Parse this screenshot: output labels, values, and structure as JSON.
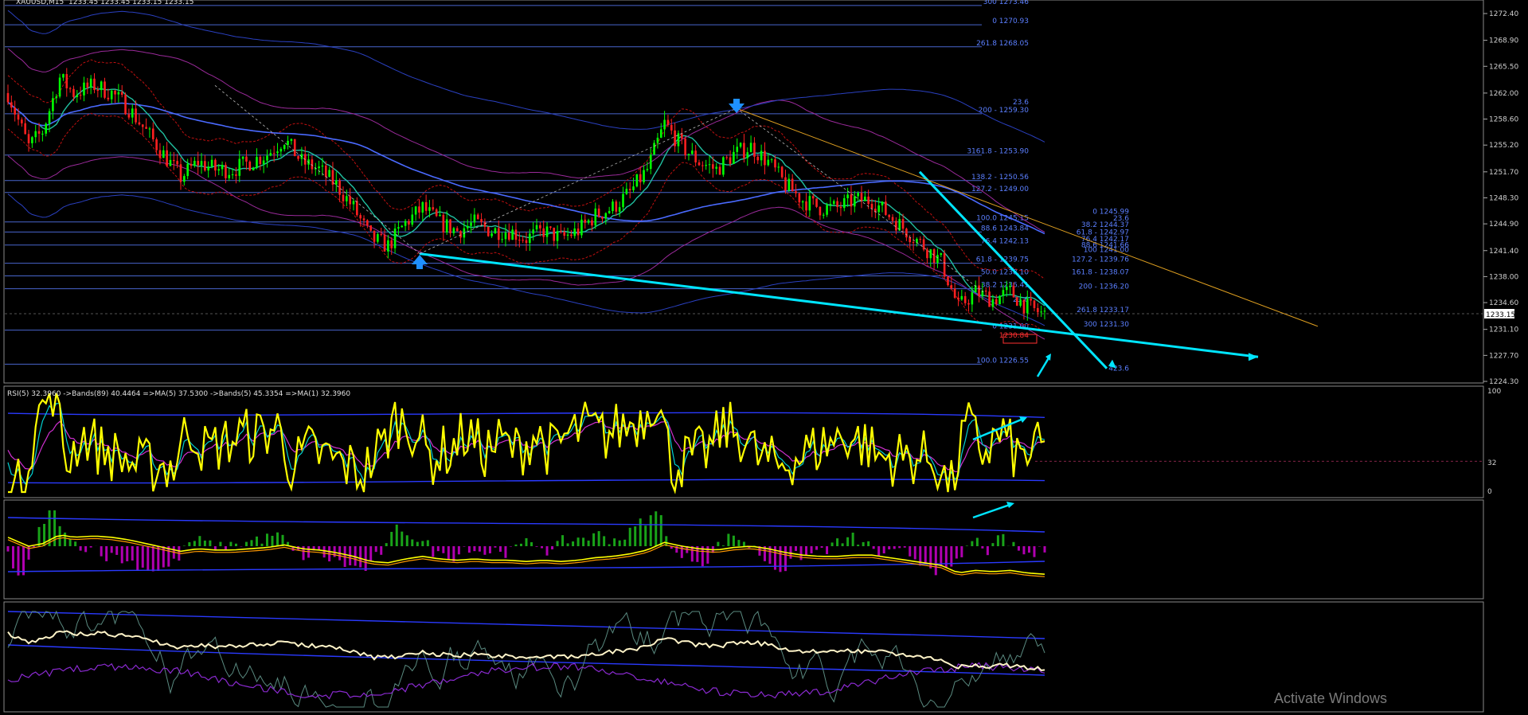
{
  "window": {
    "symbol_label": "XAUUSD,M15",
    "ohlc_label": "1233.45 1233.45 1233.15 1233.15"
  },
  "panes": {
    "rsi_label": "RSI(5) 32.3960 ->Bands(89) 40.4464 =>MA(5) 37.5300 ->Bands(5) 45.3354 =>MA(1) 32.3960",
    "rsi_scale": [
      "100",
      "32",
      "0"
    ]
  },
  "watermark": "Activate Windows",
  "colors": {
    "bull": "#00ff00",
    "bear": "#ff2020",
    "fib": "#5b7fff",
    "trend": "#00e5ff",
    "rsi": "#ffff00",
    "hist_up": "#19a319",
    "hist_down": "#b000b0"
  },
  "chart_data": {
    "type": "candlestick",
    "symbol": "XAUUSD",
    "timeframe": "M15",
    "ylim": [
      1224.3,
      1274.0
    ],
    "y_ticks": [
      "1272.40",
      "1268.90",
      "1265.50",
      "1262.00",
      "1258.60",
      "1255.20",
      "1251.70",
      "1248.30",
      "1244.90",
      "1241.40",
      "1238.00",
      "1234.60",
      "1231.10",
      "1227.70",
      "1224.30"
    ],
    "current_price": "1233.15",
    "price_path": [
      [
        0,
        1262
      ],
      [
        5,
        1259
      ],
      [
        12,
        1255
      ],
      [
        20,
        1257
      ],
      [
        30,
        1264
      ],
      [
        38,
        1262
      ],
      [
        50,
        1263
      ],
      [
        60,
        1262
      ],
      [
        70,
        1260
      ],
      [
        80,
        1257
      ],
      [
        90,
        1254
      ],
      [
        100,
        1251
      ],
      [
        110,
        1253
      ],
      [
        120,
        1252
      ],
      [
        130,
        1252
      ],
      [
        140,
        1253
      ],
      [
        150,
        1254
      ],
      [
        160,
        1256
      ],
      [
        170,
        1253
      ],
      [
        180,
        1252
      ],
      [
        190,
        1250
      ],
      [
        200,
        1247
      ],
      [
        210,
        1243
      ],
      [
        220,
        1242
      ],
      [
        230,
        1245
      ],
      [
        240,
        1247
      ],
      [
        250,
        1245
      ],
      [
        260,
        1244
      ],
      [
        270,
        1245
      ],
      [
        280,
        1244
      ],
      [
        290,
        1244
      ],
      [
        300,
        1243
      ],
      [
        310,
        1244
      ],
      [
        320,
        1243
      ],
      [
        330,
        1244
      ],
      [
        340,
        1246
      ],
      [
        350,
        1247
      ],
      [
        360,
        1249
      ],
      [
        370,
        1252
      ],
      [
        380,
        1258
      ],
      [
        390,
        1255
      ],
      [
        400,
        1253
      ],
      [
        410,
        1252
      ],
      [
        420,
        1254
      ],
      [
        430,
        1255
      ],
      [
        440,
        1253
      ],
      [
        450,
        1250
      ],
      [
        460,
        1248
      ],
      [
        470,
        1247
      ],
      [
        480,
        1247
      ],
      [
        490,
        1248
      ],
      [
        500,
        1248
      ],
      [
        510,
        1246
      ],
      [
        520,
        1244
      ],
      [
        530,
        1242
      ],
      [
        540,
        1240
      ],
      [
        550,
        1234
      ],
      [
        560,
        1236
      ],
      [
        570,
        1235
      ],
      [
        580,
        1236
      ],
      [
        590,
        1234
      ],
      [
        600,
        1233
      ]
    ],
    "fib_levels": [
      {
        "label": "300 1273.46",
        "price": 1273.46
      },
      {
        "label": "0 1270.93",
        "price": 1270.93
      },
      {
        "label": "261.8 1268.05",
        "price": 1268.05
      },
      {
        "label": "23.6",
        "price": 1260.3
      },
      {
        "label": "200 - 1259.30",
        "price": 1259.3
      },
      {
        "label": "3161.8 - 1253.90",
        "price": 1253.9
      },
      {
        "label": "138.2 - 1250.56",
        "price": 1250.56
      },
      {
        "label": "127.2 - 1249.00",
        "price": 1249.0
      },
      {
        "label": "100.0 1245.15",
        "price": 1245.15
      },
      {
        "label": "88.6 1243.84",
        "price": 1243.84
      },
      {
        "label": "76.4 1242.13",
        "price": 1242.13
      },
      {
        "label": "61.8 - 1239.75",
        "price": 1239.75
      },
      {
        "label": "50.0 1238.10",
        "price": 1238.1
      },
      {
        "label": "38.2 1236.41",
        "price": 1236.41
      },
      {
        "label": "23.6",
        "price": 1234.5
      },
      {
        "label": "0 1231.00",
        "price": 1231.0
      },
      {
        "label": "1230.84",
        "price": 1229.8
      },
      {
        "label": "100.0 1226.55",
        "price": 1226.55
      },
      {
        "label": "0 1245.99",
        "price": 1245.99
      },
      {
        "label": "23.6",
        "price": 1245.1
      },
      {
        "label": "38.2 1244.37",
        "price": 1244.3
      },
      {
        "label": "61.8 - 1242.97",
        "price": 1243.3
      },
      {
        "label": "76.4 1242.17",
        "price": 1242.4
      },
      {
        "label": "88.6 1241.66",
        "price": 1241.66
      },
      {
        "label": "100 1241.00",
        "price": 1241.0
      },
      {
        "label": "127.2 - 1239.76",
        "price": 1239.76
      },
      {
        "label": "161.8 - 1238.07",
        "price": 1238.07
      },
      {
        "label": "200 - 1236.20",
        "price": 1236.2
      },
      {
        "label": "261.8 1233.17",
        "price": 1233.17
      },
      {
        "label": "300 1231.30",
        "price": 1231.3
      },
      {
        "label": "423.6",
        "price": 1225.5
      }
    ],
    "rsi": {
      "value": 32.396,
      "ylim": [
        0,
        100
      ]
    }
  }
}
